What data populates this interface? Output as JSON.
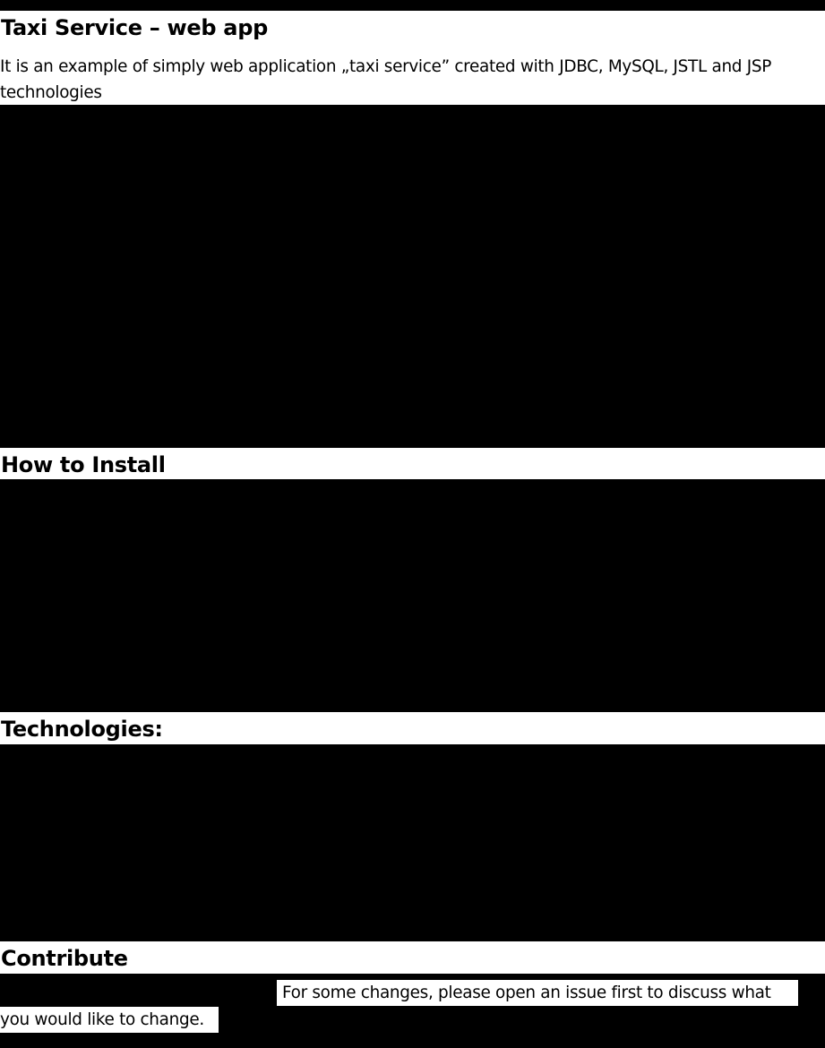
{
  "document": {
    "title": "Taxi Service – web app",
    "intro": "It is an example of simply web application „taxi service” created with JDBC, MySQL, JSTL and JSP technologies",
    "sections": {
      "install_heading": "How to Install",
      "technologies_heading": "Technologies:",
      "contribute_heading": "Contribute"
    },
    "contribute_text": {
      "line1": "For some changes, please open an issue first to discuss what",
      "line2": "you would like to change."
    }
  },
  "colors": {
    "background": "#ffffff",
    "text": "#000000",
    "redaction": "#000000"
  }
}
